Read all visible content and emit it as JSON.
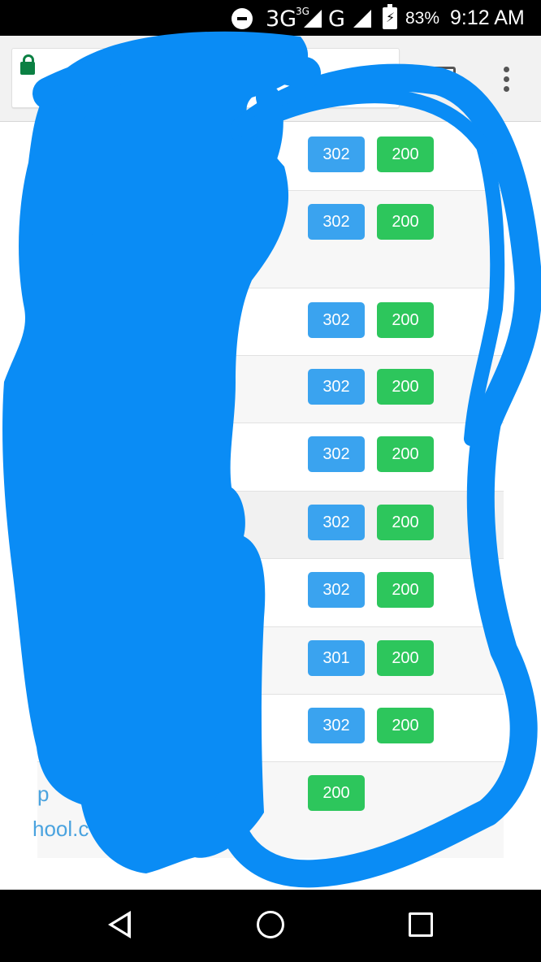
{
  "status_bar": {
    "network": "3G",
    "network_superscript": "3G",
    "carrier_g": "G",
    "battery_percent": "83%",
    "time": "9:12 AM",
    "icons": [
      "do-not-disturb-icon",
      "signal-icon",
      "battery-charging-icon"
    ]
  },
  "toolbar": {
    "tab_count": "",
    "icons": [
      "lock-icon",
      "tabs-icon",
      "overflow-menu-icon"
    ]
  },
  "rows": [
    {
      "codes": [
        "302",
        "200"
      ]
    },
    {
      "codes": [
        "302",
        "200"
      ]
    },
    {
      "codes": [
        "302",
        "200"
      ]
    },
    {
      "codes": [
        "302",
        "200"
      ]
    },
    {
      "codes": [
        "302",
        "200"
      ]
    },
    {
      "codes": [
        "302",
        "200"
      ]
    },
    {
      "codes": [
        "302",
        "200"
      ]
    },
    {
      "codes": [
        "301",
        "200"
      ]
    },
    {
      "codes": [
        "302",
        "200"
      ]
    },
    {
      "codes": [
        "200"
      ]
    }
  ],
  "partial_text": {
    "line1": "p",
    "line2": "hool.c"
  },
  "colors": {
    "redirect_badge": "#3aa3ef",
    "ok_badge": "#2dc65c",
    "scribble": "#0a8cf5",
    "link_text": "#4aa3df"
  },
  "nav_bar": {
    "icons": [
      "back-icon",
      "home-icon",
      "recents-icon"
    ]
  }
}
